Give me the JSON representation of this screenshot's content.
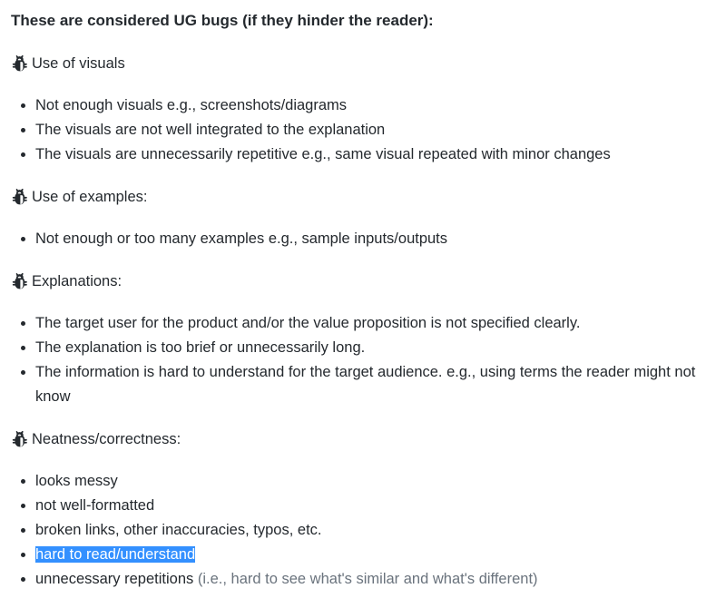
{
  "heading": "These are considered UG bugs (if they hinder the reader):",
  "sections": [
    {
      "icon": "bug-icon",
      "title": "Use of visuals",
      "items": [
        "Not enough visuals e.g., screenshots/diagrams",
        "The visuals are not well integrated to the explanation",
        "The visuals are unnecessarily repetitive e.g., same visual repeated with minor changes"
      ]
    },
    {
      "icon": "bug-icon",
      "title": "Use of examples:",
      "items": [
        "Not enough or too many examples e.g., sample inputs/outputs"
      ]
    },
    {
      "icon": "bug-icon",
      "title": "Explanations:",
      "items": [
        "The target user for the product and/or the value proposition is not specified clearly.",
        "The explanation is too brief or unnecessarily long.",
        "The information is hard to understand for the target audience. e.g., using terms the reader might not know"
      ]
    },
    {
      "icon": "bug-icon",
      "title": "Neatness/correctness:",
      "items": [
        "looks messy",
        "not well-formatted",
        "broken links, other inaccuracies, typos, etc.",
        "hard to read/understand",
        "unnecessary repetitions"
      ],
      "last_item_note": "(i.e., hard to see what's similar and what's different)"
    }
  ],
  "highlight_color": "#3390ff",
  "text_color": "#24292e",
  "muted_color": "#6a737d"
}
